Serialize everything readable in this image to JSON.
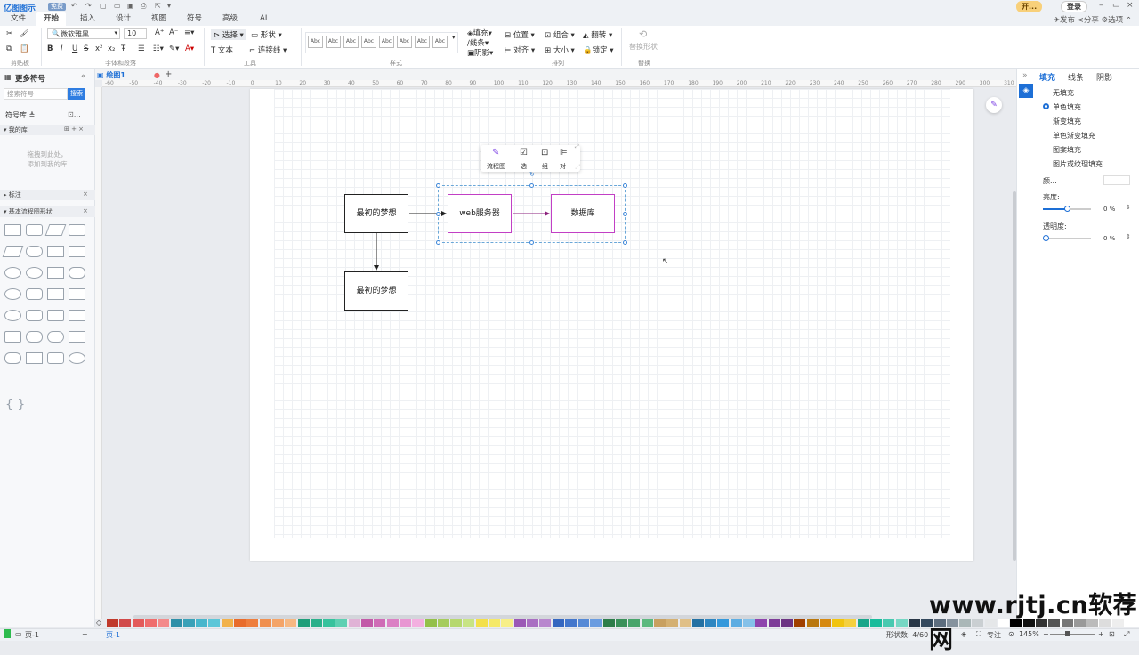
{
  "app": {
    "title": "亿图图示",
    "tag": "免费"
  },
  "window": {
    "vip": "开...",
    "login": "登录",
    "min": "–",
    "max": "▭",
    "close": "×"
  },
  "menu": {
    "tabs": [
      "文件",
      "开始",
      "插入",
      "设计",
      "视图",
      "符号",
      "高级",
      "AI"
    ],
    "active": "开始",
    "right": [
      "发布",
      "分享",
      "选项"
    ]
  },
  "ribbon": {
    "clipboard_label": "剪贴板",
    "font_label": "字体和段落",
    "tools_label": "工具",
    "style_label": "样式",
    "arrange_label": "排列",
    "replace_label": "替换",
    "font_name": "微软雅黑",
    "font_size": "10",
    "select": "选择",
    "shape": "形状",
    "text": "文本",
    "connector": "连接线",
    "fill": "填充",
    "line": "线条",
    "shadow": "阴影",
    "position": "位置",
    "group": "组合",
    "flip": "翻转",
    "align": "对齐",
    "size": "大小",
    "lock": "锁定",
    "replace_shape": "替换形状",
    "abc": "Abc",
    "bold": "B",
    "italic": "I",
    "underline": "U",
    "strike": "S"
  },
  "left_panel": {
    "title": "更多符号",
    "search_placeholder": "搜索符号",
    "search_button": "搜索",
    "library": "符号库",
    "my_library": "我的库",
    "drop_hint": "拖拽到此处，添加到我的库",
    "annotation": "标注",
    "basic_flowchart": "基本流程图形状"
  },
  "doc": {
    "tab": "绘图1",
    "add": "+"
  },
  "ruler": {
    "h_ticks": [
      "-60",
      "-50",
      "-40",
      "-30",
      "-20",
      "-10",
      "0",
      "10",
      "20",
      "30",
      "40",
      "50",
      "60",
      "70",
      "80",
      "90",
      "100",
      "110",
      "120",
      "130",
      "140",
      "150",
      "160",
      "170",
      "180",
      "190",
      "200",
      "210",
      "220",
      "230",
      "240",
      "250",
      "260",
      "270",
      "280",
      "290",
      "300",
      "310"
    ]
  },
  "diagram": {
    "nodes": {
      "start": "最初的梦想",
      "web": "web服务器",
      "db": "数据库",
      "bottom": "最初的梦想"
    }
  },
  "floating_toolbar": {
    "flow": "流程图",
    "select": "选",
    "group": "组",
    "align": "对"
  },
  "right_panel": {
    "tabs": [
      "填充",
      "线条",
      "阴影"
    ],
    "options": [
      "无填充",
      "单色填充",
      "渐变填充",
      "单色渐变填充",
      "图案填充",
      "图片或纹理填充"
    ],
    "color_label": "颜...",
    "brightness_label": "亮度:",
    "brightness_value": "0 %",
    "transparency_label": "透明度:",
    "transparency_value": "0 %"
  },
  "status": {
    "page_left": "页-1",
    "page_tab": "页-1",
    "shape_count": "形状数: 4/60",
    "focus": "专注",
    "zoom": "145%"
  },
  "watermark": "www.rjtj.cn软荐网",
  "palette": [
    "#c0392b",
    "#d14a4a",
    "#e35a5a",
    "#ef6d6d",
    "#f38a8a",
    "#2e8fa8",
    "#3aa1b8",
    "#48b6cc",
    "#5cc6d8",
    "#f2b24b",
    "#e86c2c",
    "#ee7e3e",
    "#f09050",
    "#f4a468",
    "#f6b883",
    "#1f9e7a",
    "#2bb08b",
    "#37c29d",
    "#5dd0b2",
    "#e0b3d6",
    "#c25aa8",
    "#cf6cb6",
    "#db80c4",
    "#e896d2",
    "#f3b0e0",
    "#94c04a",
    "#a5cc5c",
    "#b6d86e",
    "#c8e485",
    "#f3e04a",
    "#f5e968",
    "#f7ef88",
    "#9b59b6",
    "#a96fc2",
    "#b887ce",
    "#3567c0",
    "#4477cc",
    "#5589d6",
    "#6a9ce0",
    "#2d7d4a",
    "#3a915a",
    "#48a56b",
    "#5cb87e",
    "#c8a060",
    "#d4b072",
    "#e0c088",
    "#2471a3",
    "#2e86c1",
    "#3498db",
    "#5dade2",
    "#85c1e9",
    "#8e44ad",
    "#7d3c98",
    "#6c3483",
    "#a04000",
    "#b9770e",
    "#d68910",
    "#f1c40f",
    "#f4d03f",
    "#17a589",
    "#1abc9c",
    "#48c9b0",
    "#76d7c4",
    "#283747",
    "#34495e",
    "#5d6d7e",
    "#85929e",
    "#aab7b8",
    "#cacfd2",
    "#e5e7e9",
    "#ffffff",
    "#000000",
    "#111111",
    "#333333",
    "#555555",
    "#777777",
    "#999999",
    "#bbbbbb",
    "#dddddd",
    "#eeeeee"
  ]
}
